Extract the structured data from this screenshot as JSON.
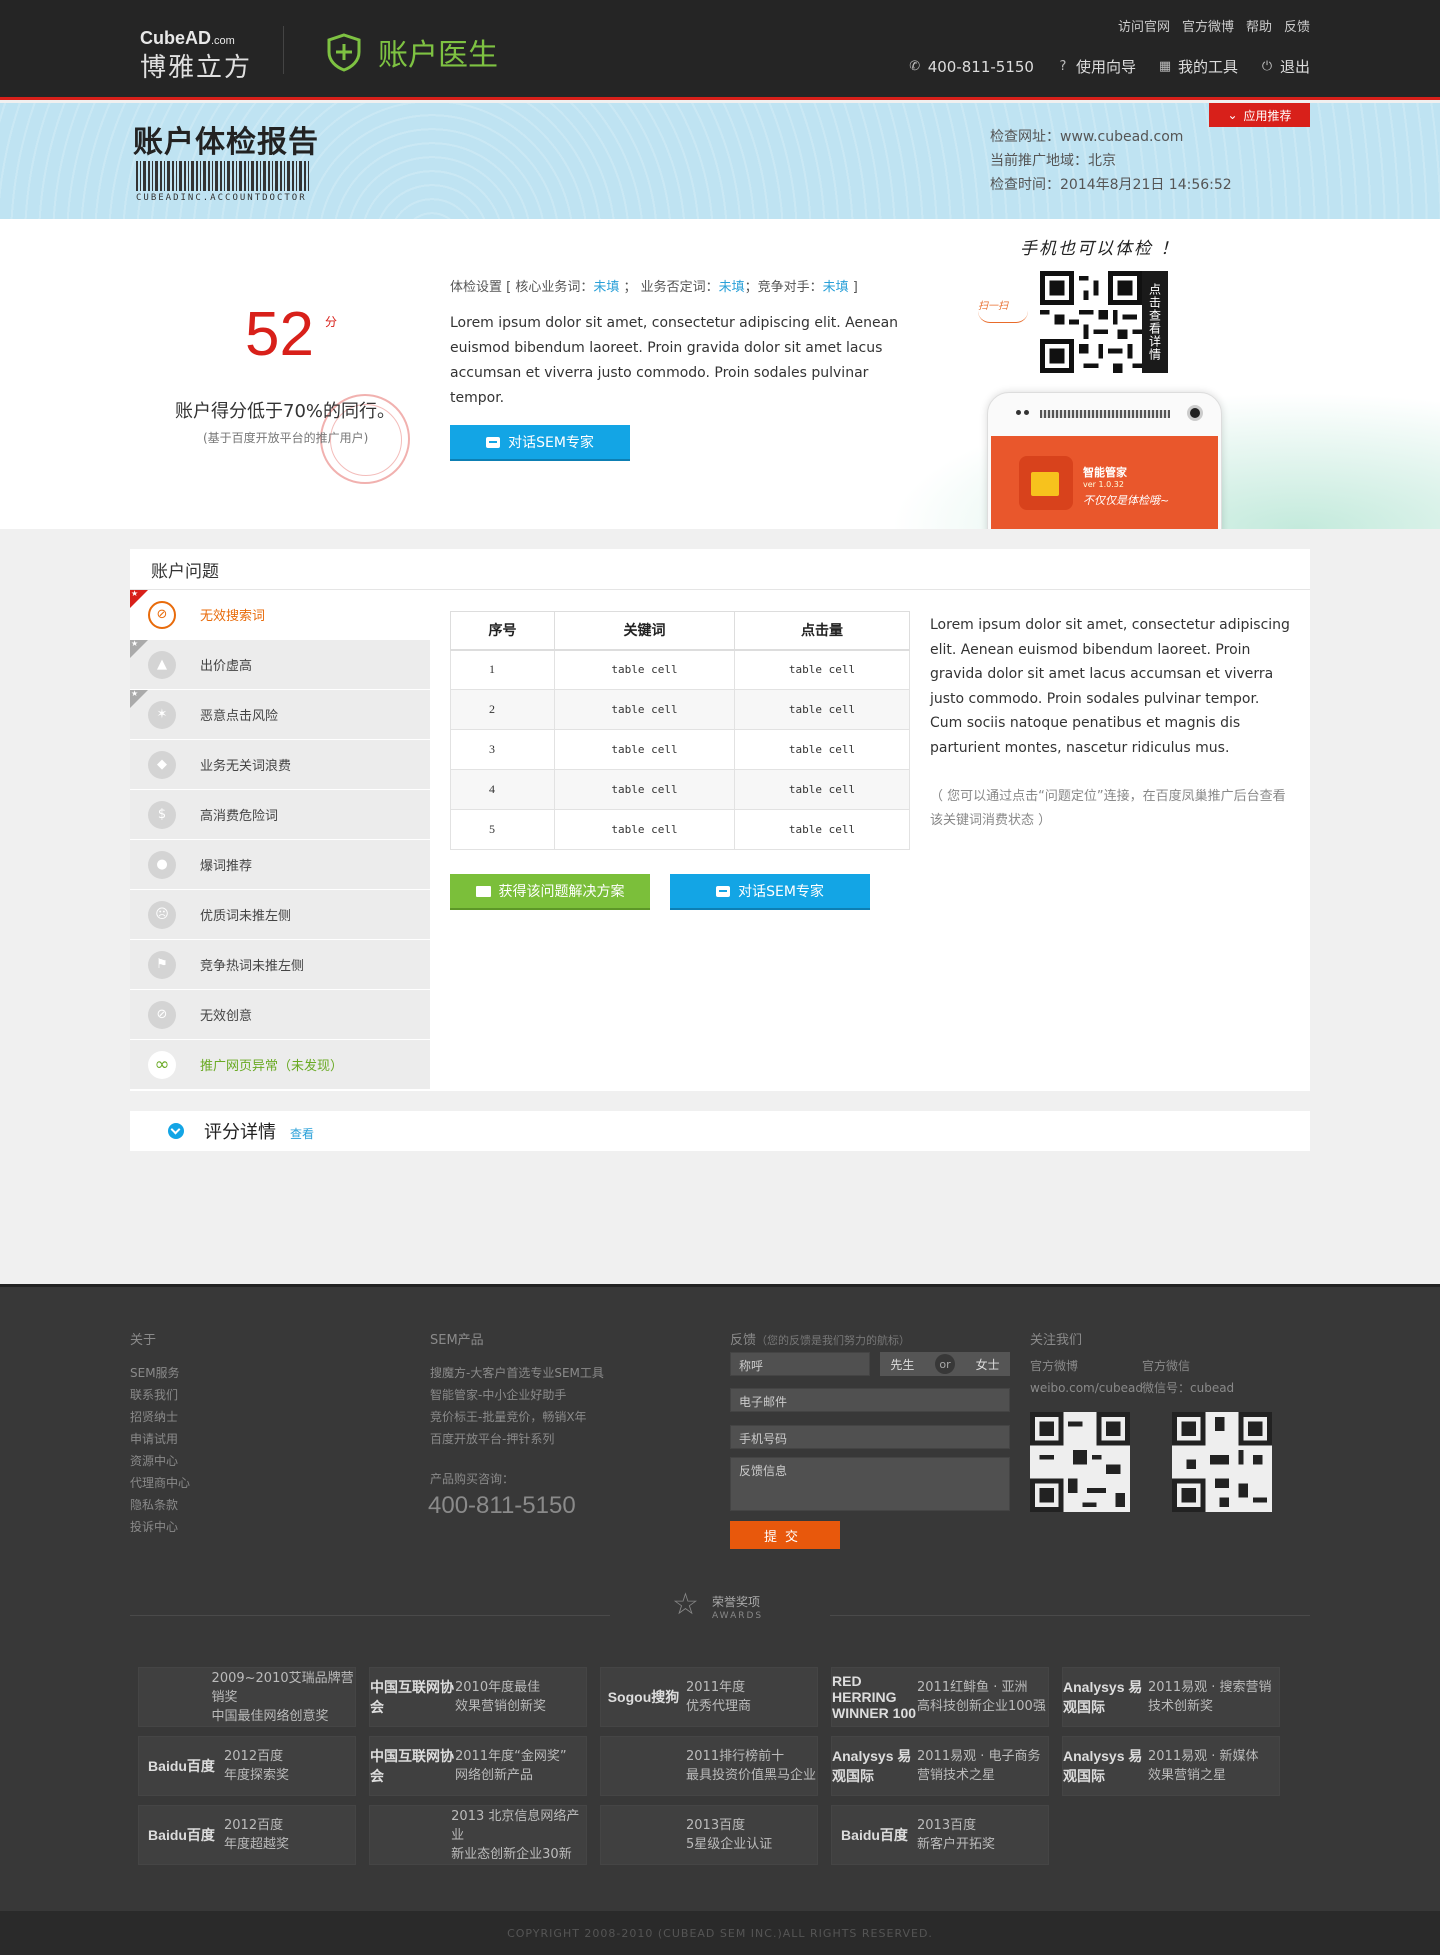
{
  "header": {
    "logo_en": "CubeAD",
    "logo_en_suffix": ".com",
    "logo_cn": "博雅立方",
    "product": "账户医生",
    "top_links": [
      "访问官网",
      "官方微博",
      "帮助",
      "反馈"
    ],
    "phone": "400-811-5150",
    "guide": "使用向导",
    "tools": "我的工具",
    "logout": "退出"
  },
  "banner": {
    "title": "账户体检报告",
    "barcode_text": "CUBEADINC.ACCOUNTDOCTOR",
    "site": "检查网址：www.cubead.com",
    "region": "当前推广地域：北京",
    "time": "检查时间：2014年8月21日 14:56:52",
    "app_rec": "应用推荐"
  },
  "score": {
    "value": "52",
    "unit": "分",
    "text": "账户得分低于70%的同行。",
    "sub": "(基于百度开放平台的推广用户)",
    "settings_prefix": "体检设置 [ 核心业务词：",
    "settings_v1": "未填",
    "settings_mid1": " ； 业务否定词：",
    "settings_v2": "未填",
    "settings_mid2": "；竞争对手：",
    "settings_v3": "未填",
    "settings_suffix": " ]",
    "lorem": "Lorem ipsum dolor sit amet, consectetur adipiscing elit. Aenean euismod bibendum laoreet. Proin gravida dolor sit amet lacus accumsan et viverra justo commodo. Proin sodales pulvinar tempor.",
    "chat_btn": "对话SEM专家",
    "mobile_note": "手机也可以体检 ！",
    "qr_side": "点击查看详情",
    "arrow_note": "扫一扫",
    "app_name": "智能管家",
    "app_ver": "ver 1.0.32",
    "app_slogan": "不仅仅是体检哦~"
  },
  "problems": {
    "title": "账户问题",
    "items": [
      {
        "label": "无效搜索词",
        "icon": "no-search-icon"
      },
      {
        "label": "出价虚高",
        "icon": "bid-high-icon"
      },
      {
        "label": "恶意点击风险",
        "icon": "click-risk-icon"
      },
      {
        "label": "业务无关词浪费",
        "icon": "tag-waste-icon"
      },
      {
        "label": "高消费危险词",
        "icon": "money-icon"
      },
      {
        "label": "爆词推荐",
        "icon": "bomb-icon"
      },
      {
        "label": "优质词未推左侧",
        "icon": "sad-face-icon"
      },
      {
        "label": "竞争热词未推左侧",
        "icon": "flag-icon"
      },
      {
        "label": "无效创意",
        "icon": "no-creative-icon"
      },
      {
        "label": "推广网页异常（未发现）",
        "icon": "link-icon"
      }
    ],
    "table": {
      "headers": [
        "序号",
        "关键词",
        "点击量"
      ],
      "rows": [
        [
          "1",
          "table cell",
          "table cell"
        ],
        [
          "2",
          "table cell",
          "table cell"
        ],
        [
          "3",
          "table cell",
          "table cell"
        ],
        [
          "4",
          "table cell",
          "table cell"
        ],
        [
          "5",
          "table cell",
          "table cell"
        ]
      ]
    },
    "lorem": "Lorem ipsum dolor sit amet, consectetur adipiscing elit. Aenean euismod bibendum laoreet. Proin gravida dolor sit amet lacus accumsan et viverra justo commodo. Proin sodales pulvinar tempor. Cum sociis natoque penatibus et magnis dis parturient montes, nascetur ridiculus mus.",
    "note": "（ 您可以通过点击“问题定位”连接，在百度凤巢推广后台查看该关键词消费状态 ）",
    "solution_btn": "获得该问题解决方案",
    "chat_btn": "对话SEM专家"
  },
  "detail": {
    "title": "评分详情",
    "link": "查看"
  },
  "footer": {
    "about_title": "关于",
    "about_links": [
      "SEM服务",
      "联系我们",
      "招贤纳士",
      "申请试用",
      "资源中心",
      "代理商中心",
      "隐私条款",
      "投诉中心"
    ],
    "sem_title": "SEM产品",
    "sem_links": [
      "搜魔方-大客户首选专业SEM工具",
      "智能管家-中小企业好助手",
      "竞价标王-批量竞价，畅销X年",
      "百度开放平台-押针系列"
    ],
    "buy_label": "产品购买咨询：",
    "buy_phone": "400-811-5150",
    "fb_title": "反馈",
    "fb_sub": "（您的反馈是我们努力的航标）",
    "fb_name": "称呼",
    "fb_mr": "先生",
    "fb_or": "or",
    "fb_ms": "女士",
    "fb_email": "电子邮件",
    "fb_mobile": "手机号码",
    "fb_msg": "反馈信息",
    "fb_submit": "提交",
    "follow_title": "关注我们",
    "weibo_label": "官方微博",
    "weixin_label": "官方微信",
    "weibo_id": "weibo.com/cubead",
    "weixin_id": "微信号：cubead",
    "awards_cn": "荣誉奖项",
    "awards_en": "AWARDS",
    "awards": [
      {
        "logo": "",
        "l1": "2009~2010艾瑞品牌营销奖",
        "l2": "中国最佳网络创意奖"
      },
      {
        "logo": "中国互联网协会",
        "l1": "2010年度最佳",
        "l2": "效果营销创新奖"
      },
      {
        "logo": "Sogou搜狗",
        "l1": "2011年度",
        "l2": "优秀代理商"
      },
      {
        "logo": "RED HERRING WINNER 100",
        "l1": "2011红鲱鱼 · 亚洲",
        "l2": "高科技创新企业100强"
      },
      {
        "logo": "Analysys 易观国际",
        "l1": "2011易观 · 搜索营销",
        "l2": "技术创新奖"
      },
      {
        "logo": "Baidu百度",
        "l1": "2012百度",
        "l2": "年度探索奖"
      },
      {
        "logo": "中国互联网协会",
        "l1": "2011年度“金网奖”",
        "l2": "网络创新产品"
      },
      {
        "logo": "",
        "l1": "2011排行榜前十",
        "l2": "最具投资价值黑马企业"
      },
      {
        "logo": "Analysys 易观国际",
        "l1": "2011易观 · 电子商务",
        "l2": "营销技术之星"
      },
      {
        "logo": "Analysys 易观国际",
        "l1": "2011易观 · 新媒体",
        "l2": "效果营销之星"
      },
      {
        "logo": "Baidu百度",
        "l1": "2012百度",
        "l2": "年度超越奖"
      },
      {
        "logo": "",
        "l1": "2013 北京信息网络产业",
        "l2": "新业态创新企业30新"
      },
      {
        "logo": "",
        "l1": "2013百度",
        "l2": "5星级企业认证"
      },
      {
        "logo": "Baidu百度",
        "l1": "2013百度",
        "l2": "新客户开拓奖"
      }
    ],
    "copyright": "COPYRIGHT 2008-2010 (CUBEAD SEM INC.)ALL RIGHTS RESERVED."
  },
  "colors": {
    "accent_red": "#d8201a",
    "blue": "#13a5e5",
    "green": "#7bbf3a",
    "orange": "#e8580c",
    "product_green": "#7ec242"
  }
}
